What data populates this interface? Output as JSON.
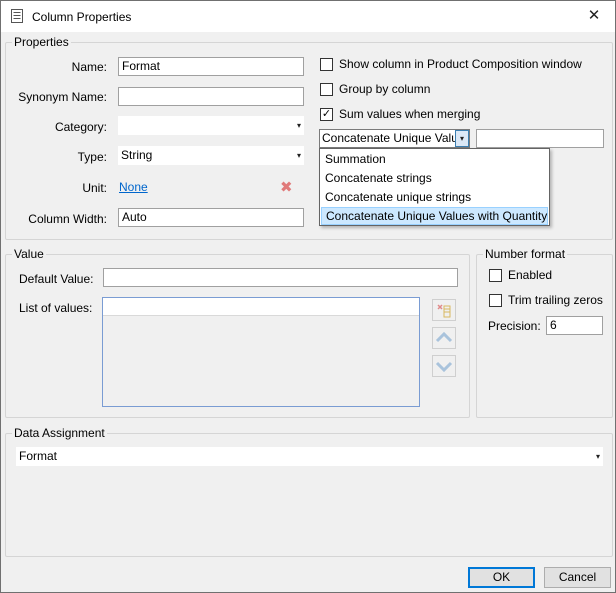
{
  "window": {
    "title": "Column Properties",
    "close_glyph": "✕"
  },
  "properties": {
    "legend": "Properties",
    "name_label": "Name:",
    "name_value": "Format",
    "synonym_label": "Synonym Name:",
    "synonym_value": "",
    "category_label": "Category:",
    "category_value": "",
    "type_label": "Type:",
    "type_value": "String",
    "unit_label": "Unit:",
    "unit_value": "None",
    "width_label": "Column Width:",
    "width_value": "Auto",
    "show_column_label": "Show column in Product Composition window",
    "show_column_checked": false,
    "group_by_label": "Group by column",
    "group_by_checked": false,
    "sum_values_label": "Sum values when merging",
    "sum_values_checked": true,
    "merge_mode_value": "Concatenate Unique Valu",
    "merge_extra_value": "",
    "merge_options": [
      "Summation",
      "Concatenate strings",
      "Concatenate unique strings",
      "Concatenate Unique Values with Quantity"
    ],
    "merge_selected_index": 3
  },
  "value": {
    "legend": "Value",
    "default_label": "Default Value:",
    "default_value": "",
    "list_label": "List of values:"
  },
  "number_format": {
    "legend": "Number format",
    "enabled_label": "Enabled",
    "enabled_checked": false,
    "trim_label": "Trim trailing zeros",
    "trim_checked": false,
    "precision_label": "Precision:",
    "precision_value": "6"
  },
  "data_assignment": {
    "legend": "Data Assignment",
    "value": "Format"
  },
  "buttons": {
    "ok": "OK",
    "cancel": "Cancel"
  },
  "icons": {
    "dropdown": "▾",
    "checkmark": "✓",
    "delete_unit": "✖"
  },
  "colors": {
    "link": "#0066cc",
    "selection": "#cce8ff",
    "accent": "#0078d7",
    "delete_red": "#e07a7a"
  }
}
